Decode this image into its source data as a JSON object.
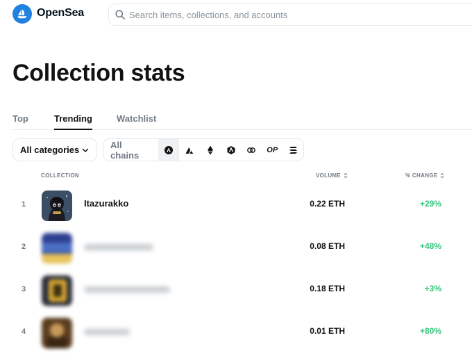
{
  "brand": {
    "name": "OpenSea",
    "logo_icon": "opensea-sailboat-icon",
    "accent": "#2081e2"
  },
  "search": {
    "placeholder": "Search items, collections, and accounts"
  },
  "page": {
    "title": "Collection stats"
  },
  "tabs": [
    {
      "label": "Top",
      "active": false
    },
    {
      "label": "Trending",
      "active": true
    },
    {
      "label": "Watchlist",
      "active": false
    }
  ],
  "filters": {
    "category": {
      "selected": "All categories"
    },
    "chains": {
      "all_label": "All chains",
      "icons": [
        "arbitrum-nova-icon",
        "avalanche-icon",
        "ethereum-icon",
        "arbitrum-icon",
        "klaytn-icon",
        "optimism-icon",
        "solana-icon"
      ],
      "optimism_text": "OP"
    }
  },
  "table": {
    "headers": {
      "collection": "COLLECTION",
      "volume": "VOLUME",
      "change": "% CHANGE"
    },
    "rows": [
      {
        "rank": "1",
        "name": "Itazurakko",
        "volume": "0.22 ETH",
        "change": "+29%",
        "blurred": false
      },
      {
        "rank": "2",
        "name": "",
        "volume": "0.08 ETH",
        "change": "+48%",
        "blurred": true
      },
      {
        "rank": "3",
        "name": "",
        "volume": "0.18 ETH",
        "change": "+3%",
        "blurred": true
      },
      {
        "rank": "4",
        "name": "",
        "volume": "0.01 ETH",
        "change": "+80%",
        "blurred": true
      }
    ]
  },
  "colors": {
    "positive_change": "#34c77b",
    "muted_text": "#707a83",
    "border": "#e5e8eb"
  }
}
